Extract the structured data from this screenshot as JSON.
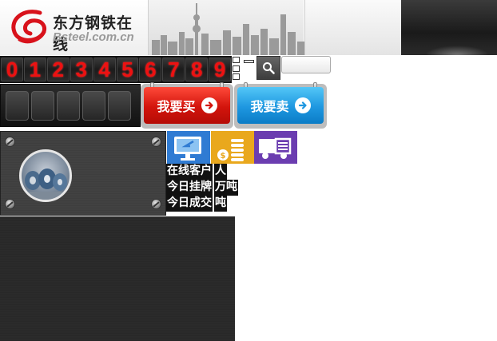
{
  "header": {
    "logo_name": "东方钢铁在线",
    "logo_domain": "Bsteel.com.cn"
  },
  "digits": [
    "0",
    "1",
    "2",
    "3",
    "4",
    "5",
    "6",
    "7",
    "8",
    "9"
  ],
  "trade": {
    "buy_label": "我要买",
    "sell_label": "我要卖"
  },
  "stats": {
    "online_label": "在线客户",
    "online_unit": "人",
    "listed_label": "今日挂牌",
    "listed_unit": "万吨",
    "deal_label": "今日成交",
    "deal_unit": "吨"
  },
  "icons": {
    "tile1": "monitor-icon",
    "tile2": "coins-icon",
    "tile3": "truck-icon"
  },
  "colors": {
    "buy": "#d2140c",
    "sell": "#1e97e0",
    "digit": "#e11111"
  }
}
